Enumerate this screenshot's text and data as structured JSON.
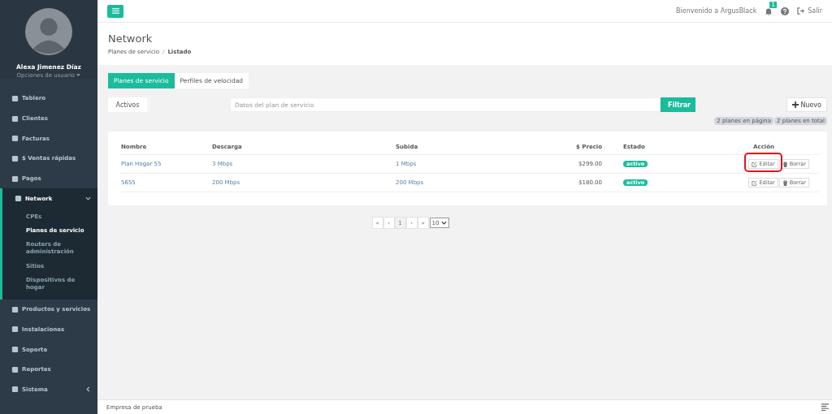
{
  "user": {
    "name": "Alexa Jimenez Díaz",
    "options": "Opciones de usuario"
  },
  "sidebar": {
    "items": [
      {
        "label": "Tablero",
        "expanded": false,
        "has_caret": false
      },
      {
        "label": "Clientes",
        "expanded": false,
        "has_caret": false
      },
      {
        "label": "Facturas",
        "expanded": false,
        "has_caret": false
      },
      {
        "label": "$ Ventas rápidas",
        "expanded": false,
        "has_caret": false
      },
      {
        "label": "Pagos",
        "expanded": false,
        "has_caret": false
      },
      {
        "label": "Network",
        "expanded": true,
        "has_caret": true,
        "children": [
          {
            "label": "CPEs",
            "selected": false
          },
          {
            "label": "Planes de servicio",
            "selected": true
          },
          {
            "label": "Routers de administración",
            "selected": false
          },
          {
            "label": "Sitios",
            "selected": false
          },
          {
            "label": "Dispositivos de hogar",
            "selected": false
          }
        ]
      },
      {
        "label": "Productos y servicios",
        "expanded": false,
        "has_caret": false
      },
      {
        "label": "Instalaciones",
        "expanded": false,
        "has_caret": false
      },
      {
        "label": "Soporte",
        "expanded": false,
        "has_caret": false
      },
      {
        "label": "Reportes",
        "expanded": false,
        "has_caret": false
      },
      {
        "label": "Sistema",
        "expanded": false,
        "has_caret": true
      }
    ]
  },
  "topbar": {
    "welcome": "Bienvenido a ArgusBlack",
    "notifications": "1",
    "logout": "Salir"
  },
  "header": {
    "title": "Network",
    "breadcrumb": [
      "Planes de servicio",
      "Listado"
    ],
    "breadcrumb_separator": "/"
  },
  "tabs": [
    {
      "label": "Planes de servicio",
      "selected": true
    },
    {
      "label": "Perfiles de velocidad",
      "selected": false
    }
  ],
  "toolbar": {
    "status_filter": "Activos",
    "search": {
      "placeholder": "Datos del plan de servicio"
    },
    "filter_button": "Filtrar",
    "new_button": "Nuevo"
  },
  "counts": [
    "2 planes en página",
    "2 planes en total"
  ],
  "table": {
    "columns": [
      "Nombre",
      "Descarga",
      "Subida",
      "$ Precio",
      "Estado",
      "Acción"
    ],
    "rows": [
      {
        "name": "Plan Hogar 55",
        "download": "3 Mbps",
        "upload": "1 Mbps",
        "price": "$299.00",
        "status": "activo",
        "edit": "Editar",
        "delete": "Borrar",
        "edit_highlighted": true
      },
      {
        "name": "5655",
        "download": "200 Mbps",
        "upload": "200 Mbps",
        "price": "$180.00",
        "status": "activo",
        "edit": "Editar",
        "delete": "Borrar",
        "edit_highlighted": false
      }
    ]
  },
  "pagination": {
    "first": "«",
    "prev": "‹",
    "page": "1",
    "next": "›",
    "last": "»",
    "page_size": "10"
  },
  "footer": "Empresa de prueba"
}
